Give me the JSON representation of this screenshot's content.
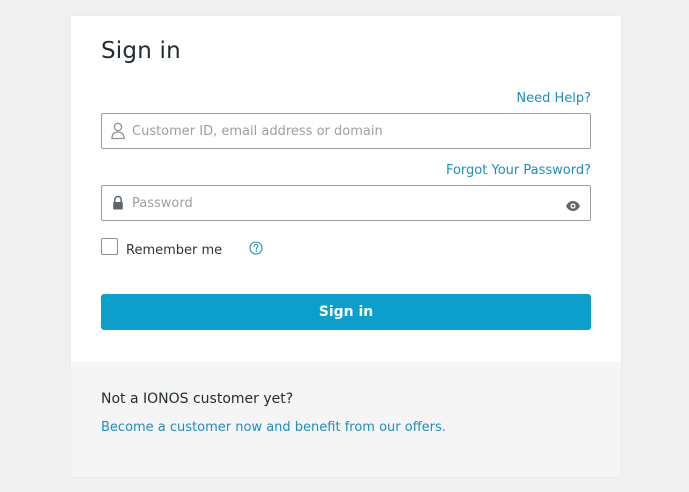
{
  "card": {
    "title": "Sign in",
    "need_help_label": "Need Help?",
    "username": {
      "placeholder": "Customer ID, email address or domain",
      "value": ""
    },
    "forgot_password_label": "Forgot Your Password?",
    "password": {
      "placeholder": "Password",
      "value": ""
    },
    "remember_me": {
      "label": "Remember me",
      "checked": false
    },
    "submit_label": "Sign in"
  },
  "footer": {
    "question": "Not a IONOS customer yet?",
    "link_label": "Become a customer now and benefit from our offers."
  },
  "icons": {
    "username": "user-icon",
    "password": "lock-icon",
    "show_password": "eye-icon",
    "help": "question-icon"
  },
  "colors": {
    "accent": "#0d9fcb",
    "link": "#1a8fc0",
    "background": "#f0f0f0",
    "footer_background": "#f5f5f5"
  }
}
